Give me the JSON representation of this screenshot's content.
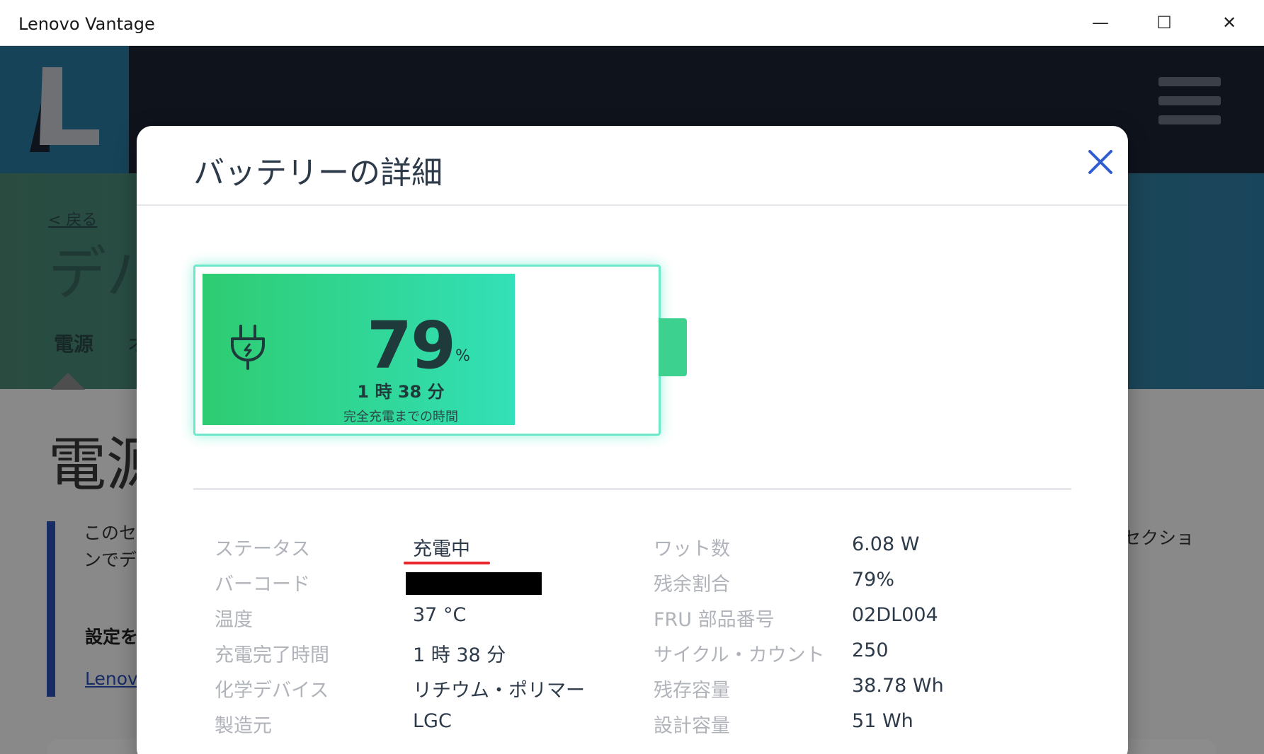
{
  "window": {
    "title": "Lenovo Vantage",
    "minimize": "—",
    "maximize": "☐",
    "close": "✕"
  },
  "background": {
    "back_link": "< 戻る",
    "hero_title": "デバ",
    "tab_power": "電源",
    "tab_next": "オ",
    "content_title": "電源",
    "note_line1": "このセク",
    "note_line2": "ンでデ",
    "note_sub": "設定を",
    "note_link": "Lenovo",
    "right_text": "セクショ"
  },
  "modal": {
    "title": "バッテリーの詳細",
    "battery": {
      "percent": "79",
      "percent_unit": "%",
      "level": 0.79,
      "time": "1 時 38 分",
      "time_label": "完全充電までの時間"
    },
    "left_details": [
      {
        "label": "ステータス",
        "value": "充電中"
      },
      {
        "label": "バーコード",
        "value": ""
      },
      {
        "label": "温度",
        "value": "37 °C"
      },
      {
        "label": "充電完了時間",
        "value": "1 時 38 分"
      },
      {
        "label": "化学デバイス",
        "value": "リチウム・ポリマー"
      },
      {
        "label": "製造元",
        "value": "LGC"
      }
    ],
    "right_details": [
      {
        "label": "ワット数",
        "value": "6.08 W"
      },
      {
        "label": "残余割合",
        "value": "79%"
      },
      {
        "label": "FRU 部品番号",
        "value": "02DL004"
      },
      {
        "label": "サイクル・カウント",
        "value": "250"
      },
      {
        "label": "残存容量",
        "value": "38.78 Wh"
      },
      {
        "label": "設計容量",
        "value": "51 Wh"
      }
    ]
  }
}
